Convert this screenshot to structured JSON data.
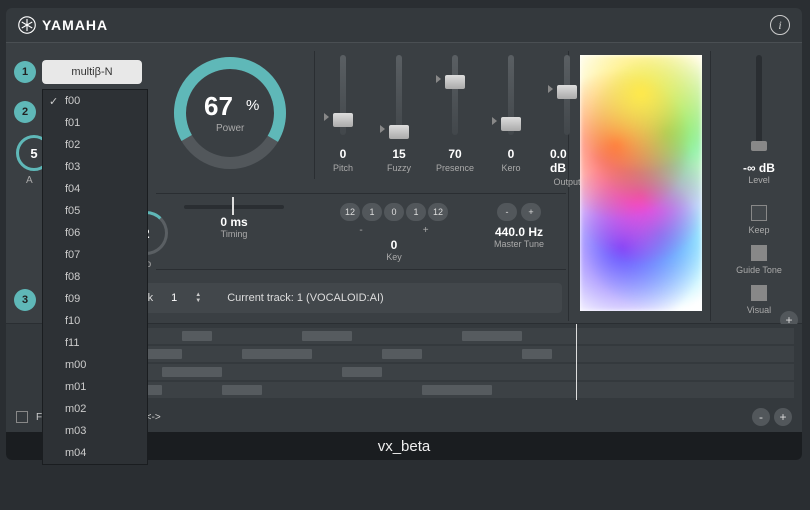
{
  "brand": "YAMAHA",
  "title": "vx_beta",
  "steps": {
    "s1": "1",
    "s2": "2",
    "s3": "3"
  },
  "pill1": "multiβ-N",
  "pill2": "f00",
  "dropdown": [
    "f00",
    "f01",
    "f02",
    "f03",
    "f04",
    "f05",
    "f06",
    "f07",
    "f08",
    "f09",
    "f10",
    "f11",
    "m00",
    "m01",
    "m02",
    "m03",
    "m04"
  ],
  "dropdown_selected": "f00",
  "attack": {
    "value": "5",
    "label": "A"
  },
  "vibrato": {
    "value": "2",
    "label": "rato"
  },
  "power": {
    "value": "67",
    "pct": "%",
    "label": "Power"
  },
  "sliders": [
    {
      "name": "Pitch",
      "value": "0",
      "pos": 58
    },
    {
      "name": "Fuzzy",
      "value": "15",
      "pos": 70
    },
    {
      "name": "Presence",
      "value": "70",
      "pos": 20
    },
    {
      "name": "Kero",
      "value": "0",
      "pos": 62
    },
    {
      "name": "Output",
      "value": "0.0 dB",
      "pos": 30
    }
  ],
  "timing": {
    "value": "0 ms",
    "label": "Timing"
  },
  "key": {
    "buttons": [
      "12",
      "1",
      "0",
      "1",
      "12"
    ],
    "minus": "-",
    "plus": "+",
    "value": "0",
    "label": "Key"
  },
  "tune": {
    "minus": "-",
    "plus": "+",
    "value": "440.0 Hz",
    "label": "Master Tune"
  },
  "track": {
    "loading": "Loading Track",
    "num": "1",
    "current": "Current track: 1 (VOCALOID:AI)"
  },
  "level": {
    "value": "-∞ dB",
    "label": "Level"
  },
  "toggles": {
    "keep": "Keep",
    "guide": "Guide Tone",
    "visual": "Visual"
  },
  "bottombar": {
    "follow": "ow <->",
    "letter": "F"
  }
}
